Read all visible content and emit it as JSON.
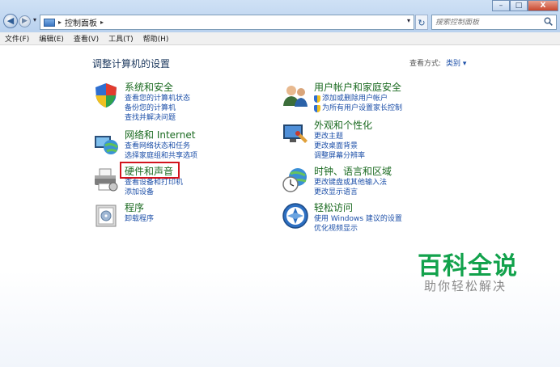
{
  "window": {
    "minimize": "–",
    "maximize": "□",
    "close": "X"
  },
  "nav": {
    "back": "◀",
    "forward": "▶",
    "history_dropdown": "▾",
    "refresh": "↻"
  },
  "address": {
    "separator": "▸",
    "path": "控制面板",
    "trailing_separator": "▸",
    "dropdown": "▾"
  },
  "search": {
    "placeholder": "搜索控制面板",
    "icon": "search-icon"
  },
  "menu": [
    "文件(F)",
    "编辑(E)",
    "查看(V)",
    "工具(T)",
    "帮助(H)"
  ],
  "page_title": "调整计算机的设置",
  "view_mode": {
    "label": "查看方式:",
    "value": "类别 ▾"
  },
  "categories": [
    {
      "title": "系统和安全",
      "links": [
        "查看您的计算机状态",
        "备份您的计算机",
        "查找并解决问题"
      ]
    },
    {
      "title": "网络和 Internet",
      "links": [
        "查看网络状态和任务",
        "选择家庭组和共享选项"
      ]
    },
    {
      "title": "硬件和声音",
      "links": [
        "查看设备和打印机",
        "添加设备"
      ]
    },
    {
      "title": "程序",
      "links": [
        "卸载程序"
      ]
    },
    {
      "title": "用户帐户和家庭安全",
      "links": [
        "添加或删除用户帐户",
        "为所有用户设置家长控制"
      ]
    },
    {
      "title": "外观和个性化",
      "links": [
        "更改主题",
        "更改桌面背景",
        "调整屏幕分辨率"
      ]
    },
    {
      "title": "时钟、语言和区域",
      "links": [
        "更改键盘或其他输入法",
        "更改显示语言"
      ]
    },
    {
      "title": "轻松访问",
      "links": [
        "使用 Windows 建议的设置",
        "优化视频显示"
      ]
    }
  ],
  "watermark": {
    "title": "百科全说",
    "subtitle": "助你轻松解决"
  },
  "colors": {
    "category_title": "#1a6a20",
    "link": "#1c4fa8",
    "highlight": "#d2141e",
    "watermark": "#12a24c"
  }
}
